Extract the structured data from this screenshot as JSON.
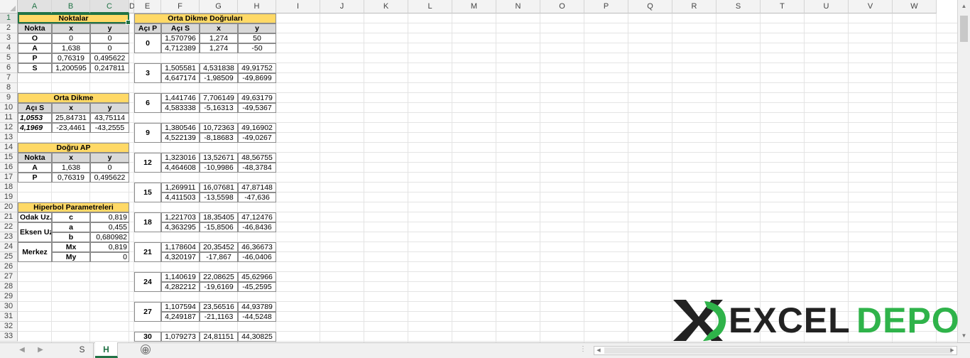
{
  "columns": [
    "A",
    "B",
    "C",
    "D",
    "E",
    "F",
    "G",
    "H",
    "I",
    "J",
    "K",
    "L",
    "M",
    "N",
    "O",
    "P",
    "Q",
    "R",
    "S",
    "T",
    "U",
    "V",
    "W"
  ],
  "rows": [
    "1",
    "2",
    "3",
    "4",
    "5",
    "6",
    "7",
    "8",
    "9",
    "10",
    "11",
    "12",
    "13",
    "14",
    "15",
    "16",
    "17",
    "18",
    "19",
    "20",
    "21",
    "22",
    "23",
    "24",
    "25",
    "26",
    "27",
    "28",
    "29",
    "30",
    "31",
    "32",
    "33"
  ],
  "noktalar": {
    "title": "Noktalar",
    "headers": [
      "Nokta",
      "x",
      "y"
    ],
    "rows": [
      [
        "O",
        "0",
        "0"
      ],
      [
        "A",
        "1,638",
        "0"
      ],
      [
        "P",
        "0,76319",
        "0,495622"
      ],
      [
        "S",
        "1,200595",
        "0,247811"
      ]
    ]
  },
  "orta_dikme": {
    "title": "Orta Dikme",
    "headers": [
      "Açı S",
      "x",
      "y"
    ],
    "rows": [
      [
        "1,0553",
        "25,84731",
        "43,75114"
      ],
      [
        "4,1969",
        "-23,4461",
        "-43,2555"
      ]
    ]
  },
  "dogru_ap": {
    "title": "Doğru AP",
    "headers": [
      "Nokta",
      "x",
      "y"
    ],
    "rows": [
      [
        "A",
        "1,638",
        "0"
      ],
      [
        "P",
        "0,76319",
        "0,495622"
      ]
    ]
  },
  "hiperbol": {
    "title": "Hiperbol Parametreleri",
    "labels": [
      "Odak Uz.",
      "Eksen Uz.",
      "Merkez"
    ],
    "rows": [
      [
        "c",
        "0,819"
      ],
      [
        "a",
        "0,455"
      ],
      [
        "b",
        "0,680982"
      ],
      [
        "Mx",
        "0,819"
      ],
      [
        "My",
        "0"
      ]
    ]
  },
  "orta_dikme_dogrulari": {
    "title": "Orta Dikme Doğruları",
    "headers": [
      "Açı P",
      "Açı S",
      "x",
      "y"
    ],
    "groups": [
      {
        "p": "0",
        "r1": [
          "1,570796",
          "1,274",
          "50"
        ],
        "r2": [
          "4,712389",
          "1,274",
          "-50"
        ]
      },
      {
        "p": "3",
        "r1": [
          "1,505581",
          "4,531838",
          "49,91752"
        ],
        "r2": [
          "4,647174",
          "-1,98509",
          "-49,8699"
        ]
      },
      {
        "p": "6",
        "r1": [
          "1,441746",
          "7,706149",
          "49,63179"
        ],
        "r2": [
          "4,583338",
          "-5,16313",
          "-49,5367"
        ]
      },
      {
        "p": "9",
        "r1": [
          "1,380546",
          "10,72363",
          "49,16902"
        ],
        "r2": [
          "4,522139",
          "-8,18683",
          "-49,0267"
        ]
      },
      {
        "p": "12",
        "r1": [
          "1,323016",
          "13,52671",
          "48,56755"
        ],
        "r2": [
          "4,464608",
          "-10,9986",
          "-48,3784"
        ]
      },
      {
        "p": "15",
        "r1": [
          "1,269911",
          "16,07681",
          "47,87148"
        ],
        "r2": [
          "4,411503",
          "-13,5598",
          "-47,636"
        ]
      },
      {
        "p": "18",
        "r1": [
          "1,221703",
          "18,35405",
          "47,12476"
        ],
        "r2": [
          "4,363295",
          "-15,8506",
          "-46,8436"
        ]
      },
      {
        "p": "21",
        "r1": [
          "1,178604",
          "20,35452",
          "46,36673"
        ],
        "r2": [
          "4,320197",
          "-17,867",
          "-46,0406"
        ]
      },
      {
        "p": "24",
        "r1": [
          "1,140619",
          "22,08625",
          "45,62966"
        ],
        "r2": [
          "4,282212",
          "-19,6169",
          "-45,2595"
        ]
      },
      {
        "p": "27",
        "r1": [
          "1,107594",
          "23,56516",
          "44,93789"
        ],
        "r2": [
          "4,249187",
          "-21,1163",
          "-44,5248"
        ]
      },
      {
        "p": "30",
        "r1": [
          "1,079273",
          "24,81151",
          "44,30825"
        ],
        "r2": []
      }
    ]
  },
  "tabs": [
    {
      "label": "S",
      "active": false
    },
    {
      "label": "H",
      "active": true
    }
  ],
  "add_sheet": "⊕",
  "logo": {
    "text_x": "X",
    "text_excel": "EXCEL",
    "text_depo": "DEPO",
    "color_dark": "#222222",
    "color_green": "#2fb34a"
  },
  "colors": {
    "accent": "#217346",
    "header_yellow": "#ffd966",
    "header_grey": "#d9d9d9"
  }
}
